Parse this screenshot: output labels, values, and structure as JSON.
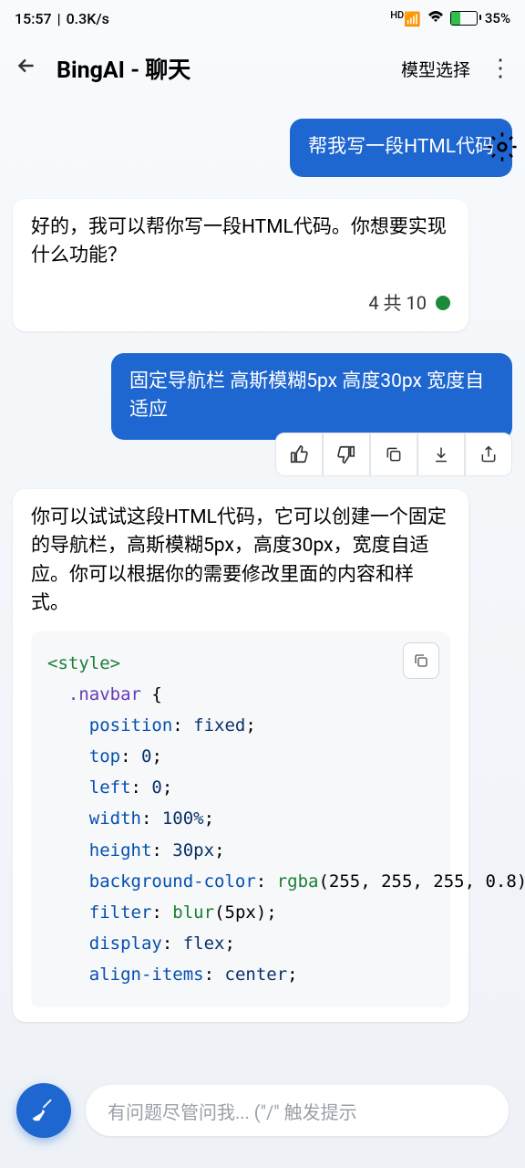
{
  "status": {
    "time": "15:57",
    "net_speed": "0.3K/s",
    "hd": "HD",
    "battery_pct": "35%"
  },
  "nav": {
    "title": "BingAI - 聊天",
    "model_select": "模型选择"
  },
  "messages": {
    "user1": "帮我写一段HTML代码",
    "assistant1": "好的，我可以帮你写一段HTML代码。你想要实现什么功能？",
    "quota": "4 共 10",
    "user2": "固定导航栏 高斯模糊5px 高度30px 宽度自适应",
    "assistant2": "你可以试试这段HTML代码，它可以创建一个固定的导航栏，高斯模糊5px，高度30px，宽度自适应。你可以根据你的需要修改里面的内容和样式。"
  },
  "code": {
    "l1_tag": "<style>",
    "l2_sel": ".navbar",
    "l2_brace": " {",
    "l3_prop": "position",
    "l3_val": "fixed",
    "l4_prop": "top",
    "l4_val": "0",
    "l5_prop": "left",
    "l5_val": "0",
    "l6_prop": "width",
    "l6_val": "100%",
    "l7_prop": "height",
    "l7_val": "30px",
    "l8_prop": "background-color",
    "l8_func": "rgba",
    "l8_args": "(255, 255, 255, 0.8)",
    "l9_prop": "filter",
    "l9_func": "blur",
    "l9_args": "(5px)",
    "l10_prop": "display",
    "l10_val": "flex",
    "l11_prop": "align-items",
    "l11_val": "center"
  },
  "input": {
    "placeholder": "有问题尽管问我... (\"/\" 触发提示"
  }
}
